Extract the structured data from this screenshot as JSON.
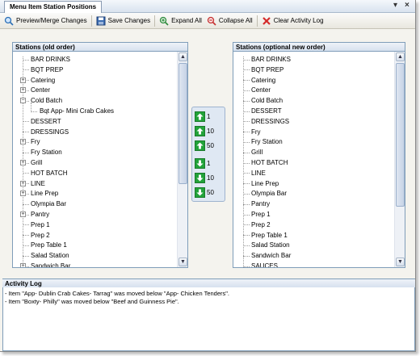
{
  "window": {
    "title": "Menu Item Station Positions",
    "pin_icon": "pin-icon",
    "close_icon": "close-icon"
  },
  "toolbar": {
    "preview_label": "Preview/Merge Changes",
    "save_label": "Save Changes",
    "expand_label": "Expand All",
    "collapse_label": "Collapse All",
    "clear_label": "Clear Activity Log"
  },
  "left_panel": {
    "title": "Stations (old order)",
    "items": [
      {
        "label": "BAR DRINKS",
        "expander": ""
      },
      {
        "label": "BQT PREP",
        "expander": ""
      },
      {
        "label": "Catering",
        "expander": "+"
      },
      {
        "label": "Center",
        "expander": "+"
      },
      {
        "label": "Cold Batch",
        "expander": "−"
      },
      {
        "label": "Bqt App- Mini Crab Cakes",
        "expander": "",
        "child": true
      },
      {
        "label": "DESSERT",
        "expander": ""
      },
      {
        "label": "DRESSINGS",
        "expander": ""
      },
      {
        "label": "Fry",
        "expander": "+"
      },
      {
        "label": "Fry Station",
        "expander": ""
      },
      {
        "label": "Grill",
        "expander": "+"
      },
      {
        "label": "HOT BATCH",
        "expander": ""
      },
      {
        "label": "LINE",
        "expander": "+"
      },
      {
        "label": "Line Prep",
        "expander": "+"
      },
      {
        "label": "Olympia Bar",
        "expander": ""
      },
      {
        "label": "Pantry",
        "expander": "+"
      },
      {
        "label": "Prep 1",
        "expander": ""
      },
      {
        "label": "Prep 2",
        "expander": ""
      },
      {
        "label": "Prep Table 1",
        "expander": ""
      },
      {
        "label": "Salad Station",
        "expander": ""
      },
      {
        "label": "Sandwich Bar",
        "expander": "+"
      }
    ]
  },
  "right_panel": {
    "title": "Stations (optional new order)",
    "items": [
      {
        "label": "BAR DRINKS"
      },
      {
        "label": "BQT PREP"
      },
      {
        "label": "Catering"
      },
      {
        "label": "Center"
      },
      {
        "label": "Cold Batch"
      },
      {
        "label": "DESSERT"
      },
      {
        "label": "DRESSINGS"
      },
      {
        "label": "Fry"
      },
      {
        "label": "Fry Station"
      },
      {
        "label": "Grill"
      },
      {
        "label": "HOT BATCH"
      },
      {
        "label": "LINE"
      },
      {
        "label": "Line Prep"
      },
      {
        "label": "Olympia Bar"
      },
      {
        "label": "Pantry"
      },
      {
        "label": "Prep 1"
      },
      {
        "label": "Prep 2"
      },
      {
        "label": "Prep Table 1"
      },
      {
        "label": "Salad Station"
      },
      {
        "label": "Sandwich Bar"
      },
      {
        "label": "SAUCES"
      }
    ]
  },
  "move_buttons": {
    "up": [
      "1",
      "10",
      "50"
    ],
    "down": [
      "1",
      "10",
      "50"
    ]
  },
  "activity_log": {
    "title": "Activity Log",
    "entries": [
      "- Item \"App- Dublin Crab Cakes- Tarrag\" was moved  below \"App- Chicken Tenders\".",
      "- Item \"Boxty- Philly\" was moved  below \"Beef and Guinness Pie\"."
    ]
  },
  "colors": {
    "accent": "#7f9db9",
    "arrow_green": "#22a33a"
  }
}
